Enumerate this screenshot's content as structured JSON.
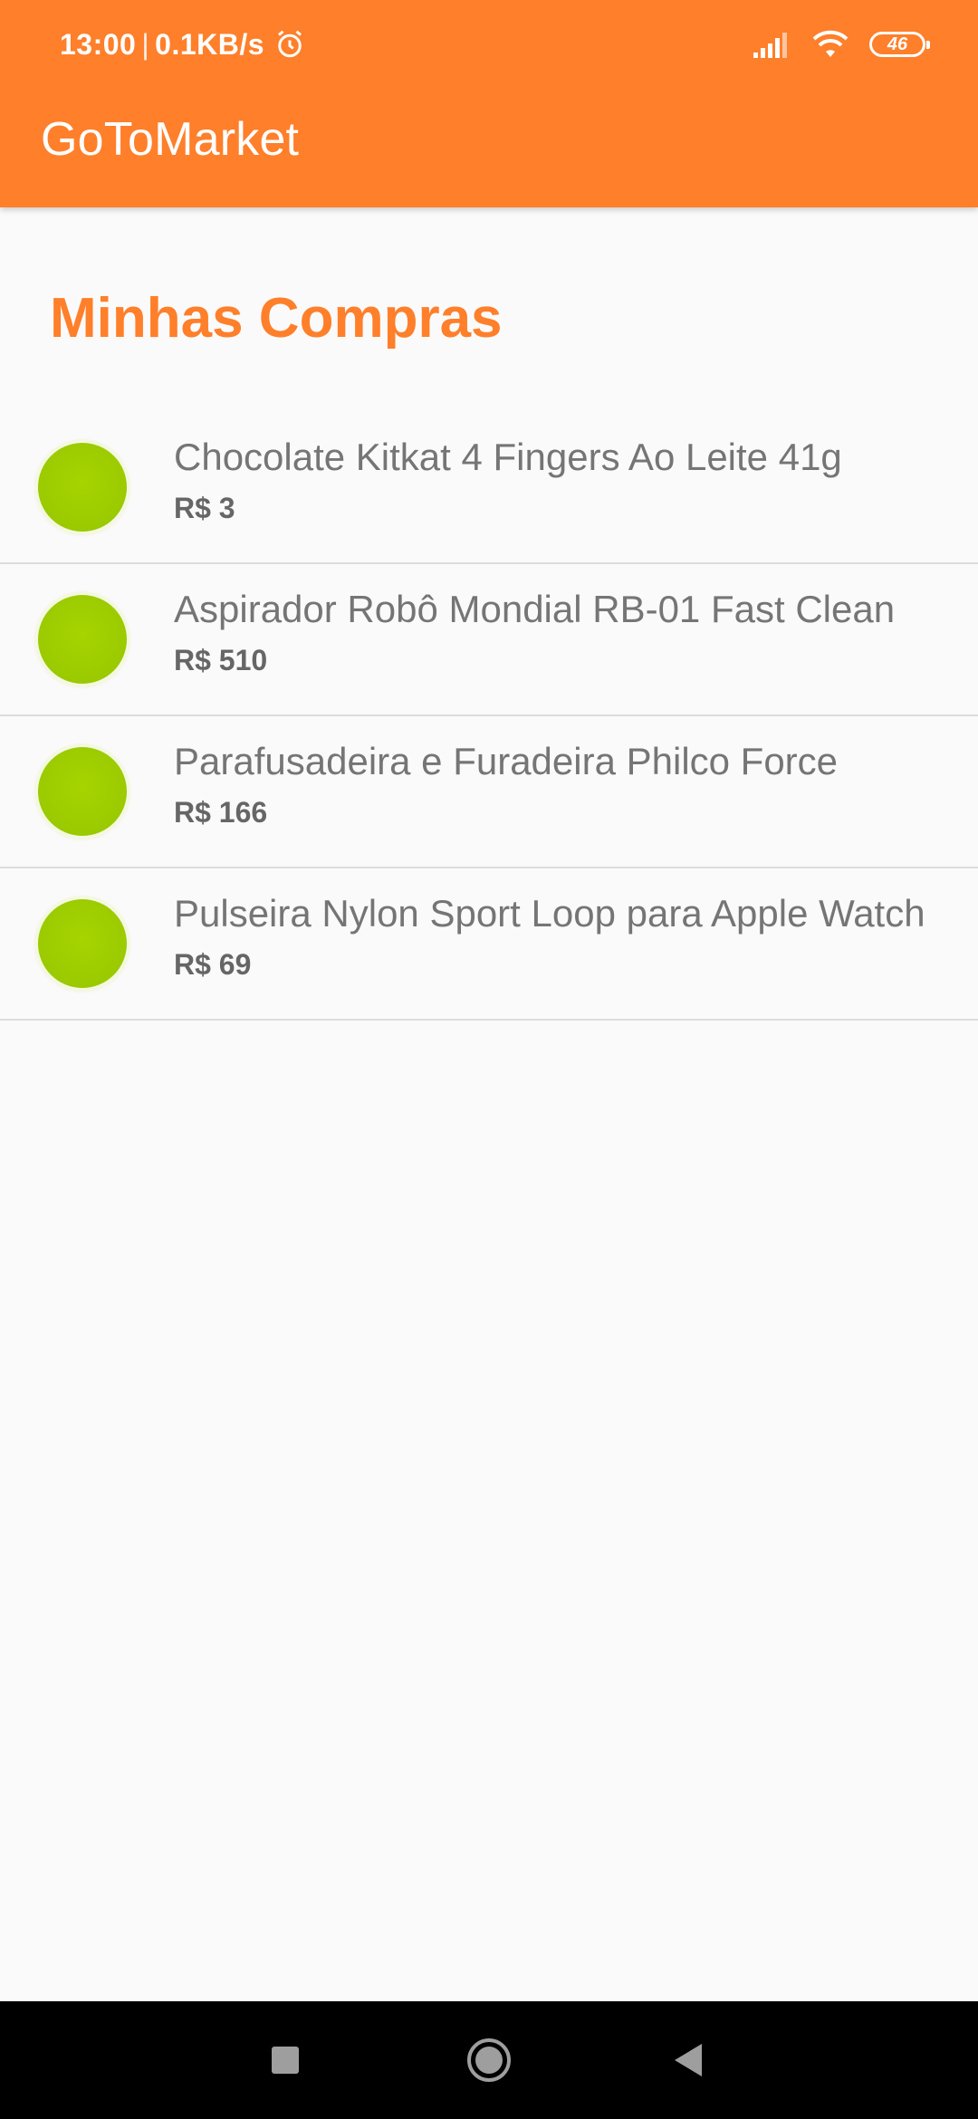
{
  "status_bar": {
    "time": "13:00",
    "separator": "|",
    "network_speed": "0.1KB/s",
    "battery": "46"
  },
  "app_bar": {
    "title": "GoToMarket"
  },
  "page": {
    "heading": "Minhas Compras"
  },
  "items": [
    {
      "name": "Chocolate Kitkat 4 Fingers Ao Leite 41g",
      "price": "R$ 3"
    },
    {
      "name": "Aspirador Robô Mondial RB-01 Fast Clean",
      "price": "R$ 510"
    },
    {
      "name": "Parafusadeira e Furadeira Philco Force",
      "price": "R$ 166"
    },
    {
      "name": "Pulseira Nylon Sport Loop para Apple Watch",
      "price": "R$ 69"
    }
  ],
  "colors": {
    "primary": "#ff7f2a",
    "item_dot": "#9ccc00",
    "background": "#fafafa"
  },
  "nav_bar": {
    "icons": [
      "recents-icon",
      "home-icon",
      "back-icon"
    ]
  }
}
